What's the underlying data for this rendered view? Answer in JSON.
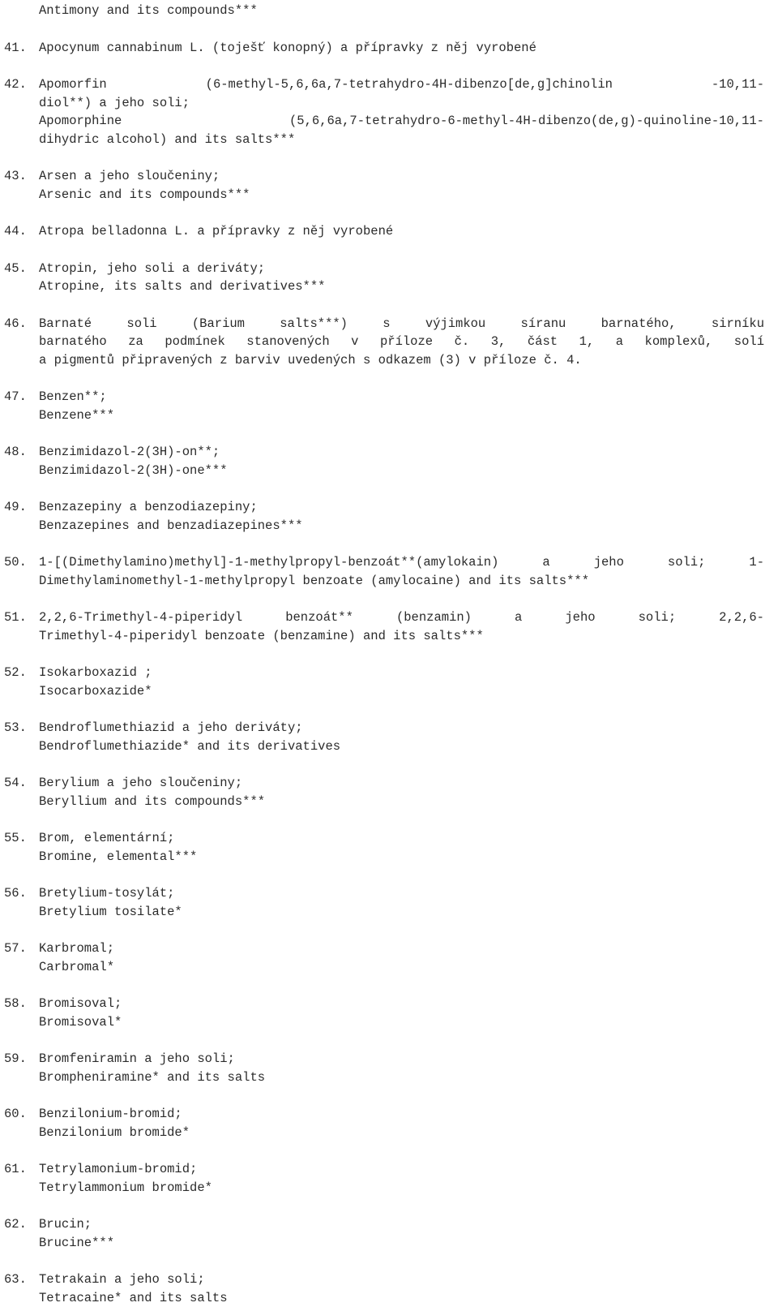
{
  "document": {
    "language_note": "Czech / English bilingual list of controlled substances",
    "orphan_line": "Antimony and its compounds***",
    "entries": [
      {
        "number": "41.",
        "lines": [
          {
            "text": "Apocynum cannabinum L. (toješť konopný) a přípravky z něj vyrobené",
            "justified": false
          }
        ]
      },
      {
        "number": "42.",
        "lines": [
          {
            "text": "Apomorfin   (6-methyl-5,6,6a,7-tetrahydro-4H-dibenzo[de,g]chinolin   -10,11-",
            "justified": true
          },
          {
            "text": "diol**) a jeho soli;",
            "justified": false
          },
          {
            "text": "Apomorphine  (5,6,6a,7-tetrahydro-6-methyl-4H-dibenzo(de,g)-quinoline-10,11-",
            "justified": true
          },
          {
            "text": "dihydric alcohol) and its salts***",
            "justified": false
          }
        ]
      },
      {
        "number": "43.",
        "lines": [
          {
            "text": "Arsen a jeho sloučeniny;",
            "justified": false
          },
          {
            "text": "Arsenic and its compounds***",
            "justified": false
          }
        ]
      },
      {
        "number": "44.",
        "lines": [
          {
            "text": "Atropa belladonna L. a přípravky z něj vyrobené",
            "justified": false
          }
        ]
      },
      {
        "number": "45.",
        "lines": [
          {
            "text": "Atropin, jeho soli a deriváty;",
            "justified": false
          },
          {
            "text": "Atropine, its salts and derivatives***",
            "justified": false
          }
        ]
      },
      {
        "number": "46.",
        "lines": [
          {
            "text": "Barnaté  soli (Barium salts***) s výjimkou síranu barnatého, sirníku",
            "justified": true
          },
          {
            "text": "barnatého  za podmínek stanovených v příloze č. 3, část 1, a komplexů, solí",
            "justified": true
          },
          {
            "text": "a pigmentů připravených z barviv uvedených s odkazem (3) v příloze č. 4.",
            "justified": false
          }
        ]
      },
      {
        "number": "47.",
        "lines": [
          {
            "text": "Benzen**;",
            "justified": false
          },
          {
            "text": "Benzene***",
            "justified": false
          }
        ]
      },
      {
        "number": "48.",
        "lines": [
          {
            "text": "Benzimidazol-2(3H)-on**;",
            "justified": false
          },
          {
            "text": "Benzimidazol-2(3H)-one***",
            "justified": false
          }
        ]
      },
      {
        "number": "49.",
        "lines": [
          {
            "text": "Benzazepiny a benzodiazepiny;",
            "justified": false
          },
          {
            "text": "Benzazepines and benzadiazepines***",
            "justified": false
          }
        ]
      },
      {
        "number": "50.",
        "lines": [
          {
            "text": "1-[(Dimethylamino)methyl]-1-methylpropyl-benzoát**(amylokain) a jeho soli; 1-",
            "justified": true
          },
          {
            "text": "Dimethylaminomethyl-1-methylpropyl benzoate (amylocaine) and its salts***",
            "justified": false
          }
        ]
      },
      {
        "number": "51.",
        "lines": [
          {
            "text": "2,2,6-Trimethyl-4-piperidyl benzoát** (benzamin) a jeho  soli;  2,2,6-",
            "justified": true
          },
          {
            "text": "Trimethyl-4-piperidyl benzoate (benzamine) and its salts***",
            "justified": false
          }
        ]
      },
      {
        "number": "52.",
        "lines": [
          {
            "text": "Isokarboxazid ;",
            "justified": false
          },
          {
            "text": "Isocarboxazide*",
            "justified": false
          }
        ]
      },
      {
        "number": "53.",
        "lines": [
          {
            "text": "Bendroflumethiazid a jeho deriváty;",
            "justified": false
          },
          {
            "text": "Bendroflumethiazide* and its derivatives",
            "justified": false
          }
        ]
      },
      {
        "number": "54.",
        "lines": [
          {
            "text": "Berylium a jeho sloučeniny;",
            "justified": false
          },
          {
            "text": "Beryllium and its compounds***",
            "justified": false
          }
        ]
      },
      {
        "number": "55.",
        "lines": [
          {
            "text": "Brom, elementární;",
            "justified": false
          },
          {
            "text": "Bromine, elemental***",
            "justified": false
          }
        ]
      },
      {
        "number": "56.",
        "lines": [
          {
            "text": "Bretylium-tosylát;",
            "justified": false
          },
          {
            "text": "Bretylium tosilate*",
            "justified": false
          }
        ]
      },
      {
        "number": "57.",
        "lines": [
          {
            "text": "Karbromal;",
            "justified": false
          },
          {
            "text": "Carbromal*",
            "justified": false
          }
        ]
      },
      {
        "number": "58.",
        "lines": [
          {
            "text": "Bromisoval;",
            "justified": false
          },
          {
            "text": "Bromisoval*",
            "justified": false
          }
        ]
      },
      {
        "number": "59.",
        "lines": [
          {
            "text": "Bromfeniramin a jeho soli;",
            "justified": false
          },
          {
            "text": "Brompheniramine* and its salts",
            "justified": false
          }
        ]
      },
      {
        "number": "60.",
        "lines": [
          {
            "text": "Benzilonium-bromid;",
            "justified": false
          },
          {
            "text": "Benzilonium bromide*",
            "justified": false
          }
        ]
      },
      {
        "number": "61.",
        "lines": [
          {
            "text": "Tetrylamonium-bromid;",
            "justified": false
          },
          {
            "text": "Tetrylammonium bromide*",
            "justified": false
          }
        ]
      },
      {
        "number": "62.",
        "lines": [
          {
            "text": "Brucin;",
            "justified": false
          },
          {
            "text": "Brucine***",
            "justified": false
          }
        ]
      },
      {
        "number": "63.",
        "lines": [
          {
            "text": "Tetrakain a jeho soli;",
            "justified": false
          },
          {
            "text": "Tetracaine* and its salts",
            "justified": false
          }
        ]
      }
    ]
  }
}
